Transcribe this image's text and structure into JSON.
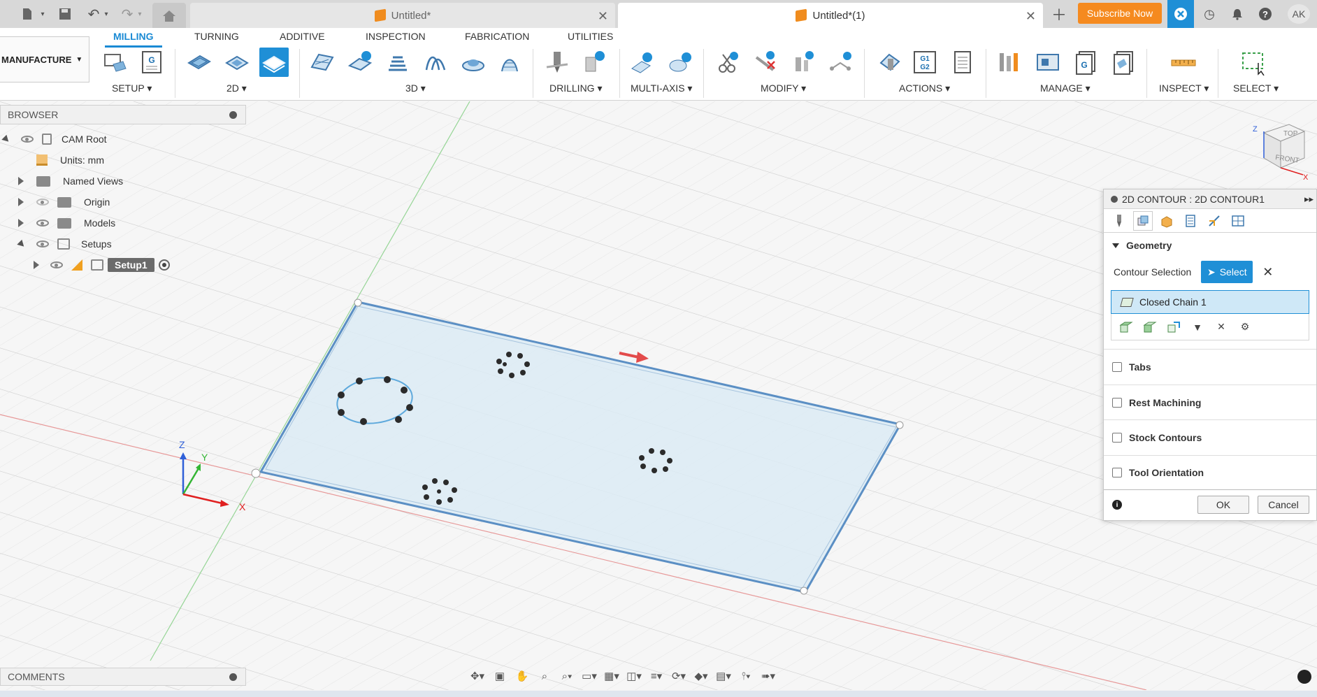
{
  "window": {
    "tabs": [
      {
        "label": "Untitled*",
        "active": false
      },
      {
        "label": "Untitled*(1)",
        "active": true
      }
    ],
    "subscribe_label": "Subscribe Now",
    "user_initials": "AK"
  },
  "toolbar": {
    "workspace_label": "MANUFACTURE",
    "ribbon_tabs": [
      "MILLING",
      "TURNING",
      "ADDITIVE",
      "INSPECTION",
      "FABRICATION",
      "UTILITIES"
    ],
    "active_tab": "MILLING",
    "groups": {
      "setup": "SETUP",
      "g2d": "2D",
      "g3d": "3D",
      "drilling": "DRILLING",
      "multiaxis": "MULTI-AXIS",
      "modify": "MODIFY",
      "actions": "ACTIONS",
      "manage": "MANAGE",
      "inspect": "INSPECT",
      "select": "SELECT"
    },
    "g1g2_text": "G1 G2",
    "g_text": "G"
  },
  "browser": {
    "title": "BROWSER",
    "items": [
      {
        "label": "CAM Root"
      },
      {
        "label": "Units: mm"
      },
      {
        "label": "Named Views"
      },
      {
        "label": "Origin"
      },
      {
        "label": "Models"
      },
      {
        "label": "Setups"
      },
      {
        "label": "Setup1"
      }
    ]
  },
  "comments": {
    "title": "COMMENTS"
  },
  "axes": {
    "x": "X",
    "y": "Y",
    "z": "Z"
  },
  "viewcube": {
    "top": "TOP",
    "front": "FRONT",
    "z": "Z",
    "x": "X"
  },
  "dialog": {
    "title": "2D CONTOUR : 2D CONTOUR1",
    "geometry_label": "Geometry",
    "contour_selection_label": "Contour Selection",
    "select_label": "Select",
    "chain_label": "Closed Chain 1",
    "sections": [
      "Tabs",
      "Rest Machining",
      "Stock Contours",
      "Tool Orientation"
    ],
    "ok_label": "OK",
    "cancel_label": "Cancel"
  },
  "colors": {
    "accent": "#1f8fd6",
    "subscribe": "#f58a1f",
    "plate_fill": "#dcebf5",
    "plate_edge": "#5b8fc4"
  }
}
